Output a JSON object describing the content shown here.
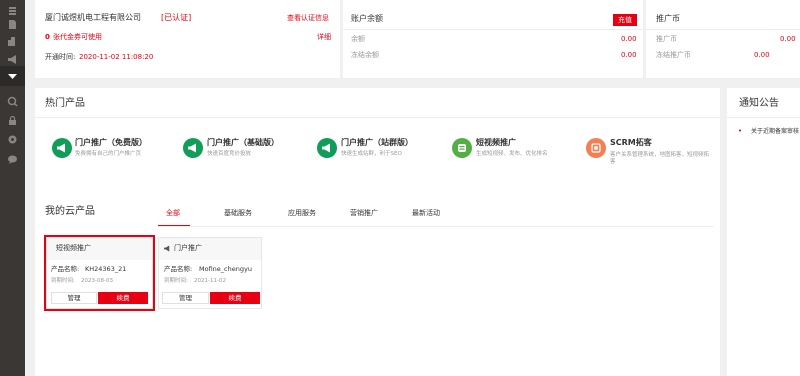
{
  "sidebar": {
    "icons": [
      "layers-icon",
      "building-icon",
      "document-icon",
      "megaphone-icon",
      "dropdown-arrow-icon",
      "analytics-icon",
      "lock-icon",
      "gear-icon",
      "chat-icon"
    ]
  },
  "company": {
    "name": "厦门诚煜机电工程有限公司",
    "verified_badge": "[已认证]",
    "view_cert_link": "查看认证信息",
    "vouchers_count": "0",
    "vouchers_text": "张代金券可使用",
    "details_link": "详细",
    "opened_label": "开通时间:",
    "opened_time": "2020-11-02 11:08:20"
  },
  "account": {
    "title": "账户余额",
    "recharge_button": "充值",
    "balance_label": "余额",
    "balance_value": "0.00",
    "frozen_label": "冻结余额",
    "frozen_value": "0.00"
  },
  "promo_coin": {
    "title": "推广币",
    "coin_label": "推广币",
    "coin_value": "0.00",
    "frozen_label": "冻结推广币",
    "frozen_value": "0.00"
  },
  "hot_products": {
    "title": "热门产品",
    "items": [
      {
        "name": "门户推广（免费版）",
        "desc": "免费拥有自己的门户推广页",
        "icon": "megaphone-icon",
        "color": "#0f9d58"
      },
      {
        "name": "门户推广（基础版）",
        "desc": "快速百度竞价投放",
        "icon": "megaphone-icon",
        "color": "#0f9d58"
      },
      {
        "name": "门户推广（站群版）",
        "desc": "快速生成站群，利于SEO",
        "icon": "megaphone-icon",
        "color": "#0f9d58"
      },
      {
        "name": "短视频推广",
        "desc": "生成短视频、发布、优化排名",
        "icon": "video-icon",
        "color": "#52b043"
      },
      {
        "name": "SCRM拓客",
        "desc": "客户关系管理系统，地图拓客，短视频拓客",
        "icon": "scrm-icon",
        "color": "#f47f53"
      }
    ]
  },
  "cloud_products": {
    "title": "我的云产品",
    "tabs": [
      "全部",
      "基础服务",
      "应用服务",
      "营销推广",
      "最新活动"
    ],
    "active_tab": 0,
    "cards": [
      {
        "name": "短视频推广",
        "icon": "video-icon",
        "product_label": "产品名称:",
        "product_value": "KH24363_21",
        "expire_label": "到期时间:",
        "expire_value": "2023-08-03",
        "manage_button": "管理",
        "renew_button": "续费"
      },
      {
        "name": "门户推广",
        "icon": "megaphone-icon",
        "product_label": "产品名称:",
        "product_value": "Mofine_chengyu",
        "expire_label": "到期时间:",
        "expire_value": "2021-11-02",
        "manage_button": "管理",
        "renew_button": "续费"
      }
    ]
  },
  "notices": {
    "title": "通知公告",
    "items": [
      "关于近期备案审核"
    ]
  },
  "colors": {
    "accent": "#e60012",
    "sidebar": "#3a3734",
    "green": "#0f9d58",
    "orange": "#f47f53"
  }
}
